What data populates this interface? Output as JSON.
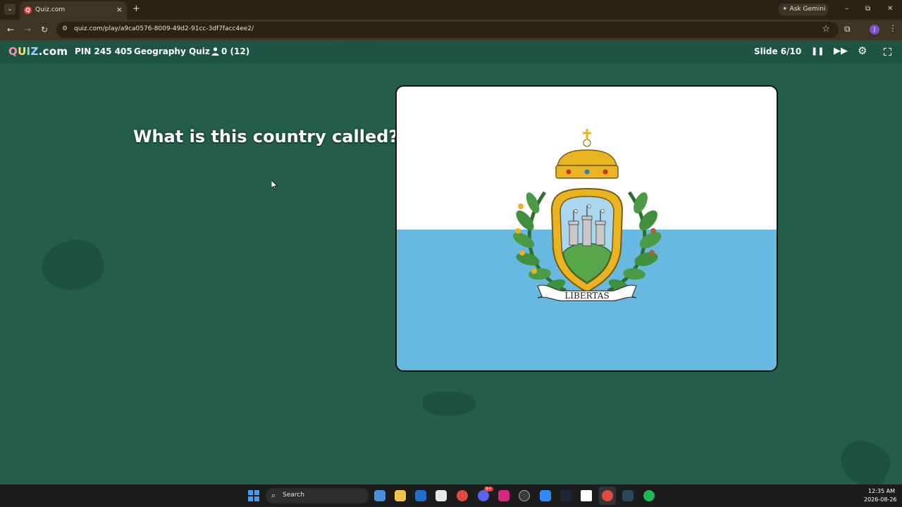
{
  "browser": {
    "tab_title": "Quiz.com",
    "tab_close": "×",
    "new_tab": "+",
    "tab_list": "⌄",
    "ask_gemini": "Ask Gemini",
    "url": "quiz.com/play/a9ca0576-8009-49d2-91cc-3df7facc4ee2/",
    "profile_initial": "J",
    "window_controls": {
      "minimize": "–",
      "restore": "⧉",
      "close": "✕"
    },
    "icons": {
      "back": "back-arrow-icon",
      "forward": "forward-arrow-icon",
      "reload": "reload-icon",
      "site_info": "site-info-icon",
      "bookmark": "star-icon",
      "extensions": "puzzle-icon",
      "menu": "more-vert-icon"
    }
  },
  "quiz_header": {
    "logo": {
      "q": "Q",
      "u": "U",
      "i": "I",
      "z": "Z",
      "suffix": ".com"
    },
    "pin": "PIN 245 405",
    "quiz_title": "Geography Quiz",
    "players": "0 (12)",
    "slide": "Slide 6/10",
    "icons": [
      "pause-icon",
      "skip-forward-icon",
      "settings-gear-icon",
      "fullscreen-icon"
    ]
  },
  "question": {
    "text": "What is this country called?"
  },
  "flag": {
    "motto": "LIBERTAS",
    "colors": {
      "top": "#ffffff",
      "bottom": "#68b9e1",
      "gold": "#e8b422",
      "green": "#3f8f3c"
    }
  },
  "taskbar": {
    "search_placeholder": "Search",
    "time": "12:35 AM",
    "date": "2026-08-26",
    "apps": [
      "photos-icon",
      "file-explorer-icon",
      "outlook-icon",
      "store-icon",
      "chrome-icon",
      "discord-icon",
      "instagram-icon",
      "copilot-icon",
      "zoom-icon",
      "steam-icon",
      "messenger-icon",
      "chrome-active-icon",
      "steam-2-icon",
      "spotify-icon"
    ],
    "badge": "9+"
  },
  "colors": {
    "background": "#245d4c",
    "header": "#1f5444",
    "browser_frame": "#3c3524"
  }
}
